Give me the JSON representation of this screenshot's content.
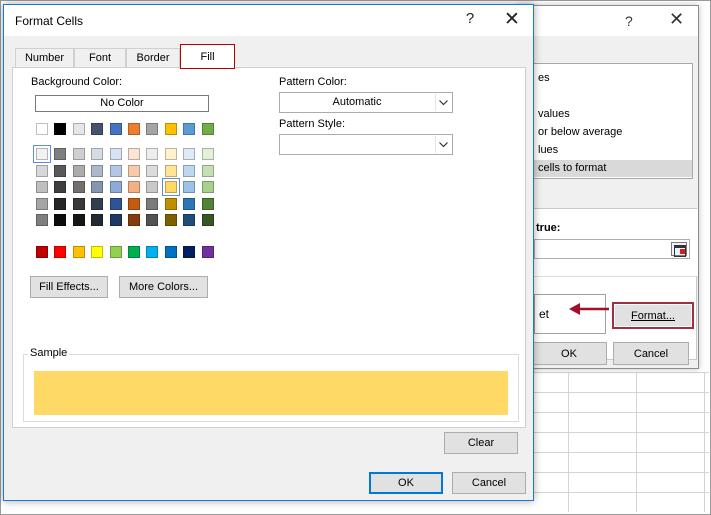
{
  "format_cells": {
    "title": "Format Cells",
    "help_glyph": "?",
    "close_glyph": "✕",
    "tabs": [
      {
        "label": "Number"
      },
      {
        "label": "Font"
      },
      {
        "label": "Border"
      },
      {
        "label": "Fill",
        "active": true
      }
    ],
    "background_color_label": "Background Color:",
    "no_color_label": "No Color",
    "pattern_color_label": "Pattern Color:",
    "pattern_color_value": "Automatic",
    "pattern_style_label": "Pattern Style:",
    "pattern_style_value": "",
    "fill_effects_label": "Fill Effects...",
    "more_colors_label": "More Colors...",
    "sample_label": "Sample",
    "sample_color": "#FFD966",
    "clear_label": "Clear",
    "ok_label": "OK",
    "cancel_label": "Cancel",
    "selected_color": "#FFD966",
    "theme_colors": [
      [
        "#FFFFFF",
        "#000000",
        "#E7E6E6",
        "#44546A",
        "#4472C4",
        "#ED7D31",
        "#A5A5A5",
        "#FFC000",
        "#5B9BD5",
        "#70AD47"
      ],
      [
        "#F2F2F2",
        "#7F7F7F",
        "#D0CECE",
        "#D6DCE4",
        "#D9E2F3",
        "#FBE5D5",
        "#EDEDED",
        "#FFF2CC",
        "#DEEAF6",
        "#E2EFD9"
      ],
      [
        "#D8D8D8",
        "#595959",
        "#AEABAB",
        "#ADB9CA",
        "#B4C6E7",
        "#F7CAAC",
        "#DBDBDB",
        "#FFE599",
        "#BDD7EE",
        "#C5E0B3"
      ],
      [
        "#BFBFBF",
        "#3F3F3F",
        "#757070",
        "#8496B0",
        "#8EAADB",
        "#F4B083",
        "#C9C9C9",
        "#FFD966",
        "#9CC3E5",
        "#A8D08D"
      ],
      [
        "#A5A5A5",
        "#262626",
        "#3A3838",
        "#323F4F",
        "#2F5496",
        "#C55A11",
        "#7B7B7B",
        "#BF8F00",
        "#2E75B5",
        "#538135"
      ],
      [
        "#7F7F7F",
        "#0C0C0C",
        "#171616",
        "#222A35",
        "#1F3864",
        "#833C0B",
        "#525252",
        "#7F6000",
        "#1E4E79",
        "#375623"
      ]
    ],
    "standard_colors": [
      "#C00000",
      "#FF0000",
      "#FFC000",
      "#FFFF00",
      "#92D050",
      "#00B050",
      "#00B0F0",
      "#0070C0",
      "#002060",
      "#7030A0"
    ]
  },
  "rule_dialog": {
    "help_glyph": "?",
    "close_glyph": "✕",
    "rule_types": [
      {
        "label": "es"
      },
      {
        "label": ""
      },
      {
        "label": "values"
      },
      {
        "label": "or below average"
      },
      {
        "label": "lues"
      },
      {
        "label": "cells to format",
        "selected": true
      }
    ],
    "formula_label": "true:",
    "preview_text": "et",
    "format_label": "Format...",
    "ok_label": "OK",
    "cancel_label": "Cancel",
    "arrow_color": "#A0102A"
  }
}
